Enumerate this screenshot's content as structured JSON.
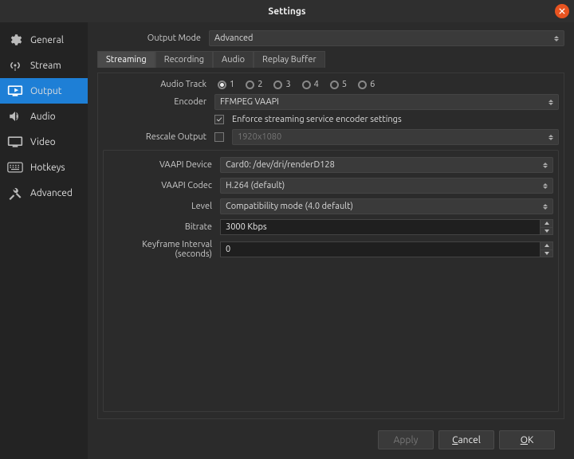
{
  "window": {
    "title": "Settings"
  },
  "sidebar": {
    "items": [
      {
        "label": "General"
      },
      {
        "label": "Stream"
      },
      {
        "label": "Output"
      },
      {
        "label": "Audio"
      },
      {
        "label": "Video"
      },
      {
        "label": "Hotkeys"
      },
      {
        "label": "Advanced"
      }
    ]
  },
  "outputMode": {
    "label": "Output Mode",
    "value": "Advanced"
  },
  "tabs": {
    "streaming": "Streaming",
    "recording": "Recording",
    "audio": "Audio",
    "replay": "Replay Buffer"
  },
  "audioTrack": {
    "label": "Audio Track",
    "options": [
      "1",
      "2",
      "3",
      "4",
      "5",
      "6"
    ],
    "selected": "1"
  },
  "encoder": {
    "label": "Encoder",
    "value": "FFMPEG VAAPI"
  },
  "enforce": {
    "label": "Enforce streaming service encoder settings",
    "checked": true
  },
  "rescale": {
    "label": "Rescale Output",
    "checked": false,
    "value": "1920x1080"
  },
  "vaapi": {
    "device": {
      "label": "VAAPI Device",
      "value": "Card0: /dev/dri/renderD128"
    },
    "codec": {
      "label": "VAAPI Codec",
      "value": "H.264 (default)"
    },
    "level": {
      "label": "Level",
      "value": "Compatibility mode  (4.0 default)"
    },
    "bitrate": {
      "label": "Bitrate",
      "value": "3000 Kbps"
    },
    "keyframe": {
      "label": "Keyframe Interval (seconds)",
      "value": "0"
    }
  },
  "footer": {
    "apply": "Apply",
    "cancel": "Cancel",
    "ok": "OK"
  }
}
